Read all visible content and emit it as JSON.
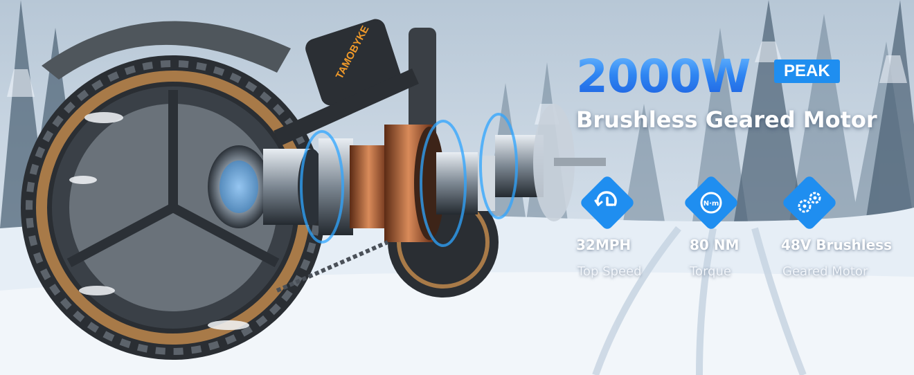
{
  "headline": {
    "power": "2000W",
    "badge": "PEAK",
    "subtitle": "Brushless Geared Motor"
  },
  "brand_on_frame": "TAMOBYKE",
  "features": [
    {
      "icon": "speedometer-icon",
      "value": "32MPH",
      "label": "Top Speed"
    },
    {
      "icon": "torque-nm-icon",
      "value": "80 NM",
      "label": "Torque"
    },
    {
      "icon": "motor-gears-icon",
      "value": "48V Brushless",
      "label": "Geared Motor"
    }
  ],
  "colors": {
    "accent_blue": "#1f8ef0",
    "headline_gradient_top": "#6ab8ff",
    "headline_gradient_bottom": "#1d5fe0",
    "tire_sidewall": "#a87a48"
  }
}
